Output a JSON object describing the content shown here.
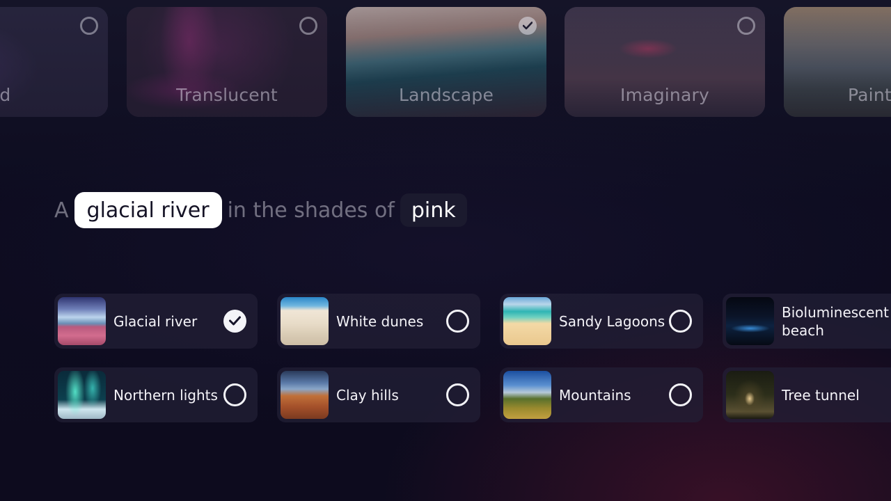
{
  "styles": [
    {
      "label": "rushed",
      "selected": false
    },
    {
      "label": "Translucent",
      "selected": false
    },
    {
      "label": "Landscape",
      "selected": true
    },
    {
      "label": "Imaginary",
      "selected": false
    },
    {
      "label": "Paint",
      "selected": false
    }
  ],
  "prompt": {
    "prefix": "A",
    "subject": "glacial river",
    "middle": "in the shades of",
    "color": "pink"
  },
  "subjects": [
    {
      "label": "Glacial river",
      "selected": true
    },
    {
      "label": "White dunes",
      "selected": false
    },
    {
      "label": "Sandy Lagoons",
      "selected": false
    },
    {
      "label": "Bioluminescent beach",
      "selected": false
    },
    {
      "label": "Northern lights",
      "selected": false
    },
    {
      "label": "Clay hills",
      "selected": false
    },
    {
      "label": "Mountains",
      "selected": false
    },
    {
      "label": "Tree tunnel",
      "selected": false
    }
  ]
}
